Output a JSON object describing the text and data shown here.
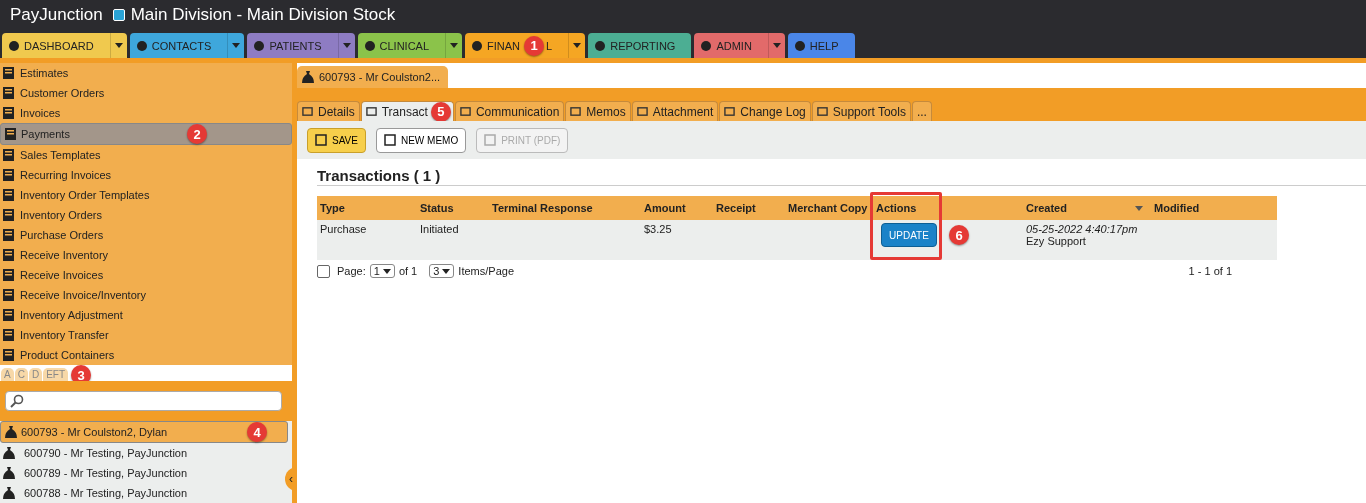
{
  "header": {
    "app": "PayJunction",
    "division": "Main Division - Main Division Stock"
  },
  "nav": [
    {
      "label": "DASHBOARD",
      "color": "#f0c94e",
      "dropdown": true
    },
    {
      "label": "CONTACTS",
      "color": "#3ea7dc",
      "dropdown": true
    },
    {
      "label": "PATIENTS",
      "color": "#8e7cc3",
      "dropdown": true
    },
    {
      "label": "CLINICAL",
      "color": "#8bc34a",
      "dropdown": true
    },
    {
      "label": "FINAN",
      "label_after": "L",
      "badge": "1",
      "color": "#f5a623",
      "dropdown": true
    },
    {
      "label": "REPORTING",
      "color": "#4cae93",
      "dropdown": false
    },
    {
      "label": "ADMIN",
      "color": "#e26a6a",
      "dropdown": true
    },
    {
      "label": "HELP",
      "color": "#4a86e8",
      "dropdown": false
    }
  ],
  "sidebar": {
    "items": [
      {
        "label": "Estimates",
        "selected": false
      },
      {
        "label": "Customer Orders",
        "selected": false
      },
      {
        "label": "Invoices",
        "selected": false
      },
      {
        "label": "Payments",
        "selected": true,
        "badge": "2"
      },
      {
        "label": "Sales Templates",
        "selected": false
      },
      {
        "label": "Recurring Invoices",
        "selected": false
      },
      {
        "label": "Inventory Order Templates",
        "selected": false
      },
      {
        "label": "Inventory Orders",
        "selected": false
      },
      {
        "label": "Purchase Orders",
        "selected": false
      },
      {
        "label": "Receive Inventory",
        "selected": false
      },
      {
        "label": "Receive Invoices",
        "selected": false
      },
      {
        "label": "Receive Invoice/Inventory",
        "selected": false
      },
      {
        "label": "Inventory Adjustment",
        "selected": false
      },
      {
        "label": "Inventory Transfer",
        "selected": false
      },
      {
        "label": "Product Containers",
        "selected": false
      }
    ],
    "filter_tabs": [
      "A",
      "C",
      "D",
      "EFT"
    ],
    "filter_badge": "3",
    "results": [
      {
        "label": "600793 - Mr Coulston2, Dylan",
        "selected": true,
        "badge": "4"
      },
      {
        "label": "600790 - Mr Testing, PayJunction",
        "selected": false
      },
      {
        "label": "600789 - Mr Testing, PayJunction",
        "selected": false
      },
      {
        "label": "600788 - Mr Testing, PayJunction",
        "selected": false
      }
    ],
    "collapse": "‹"
  },
  "record_tab": "600793 - Mr Coulston2...",
  "tabs": [
    {
      "label": "Details",
      "selected": false
    },
    {
      "label": "Transact",
      "selected": true,
      "badge": "5"
    },
    {
      "label": "Communication",
      "selected": false
    },
    {
      "label": "Memos",
      "selected": false
    },
    {
      "label": "Attachment",
      "selected": false
    },
    {
      "label": "Change Log",
      "selected": false
    },
    {
      "label": "Support Tools",
      "selected": false
    },
    {
      "label": "...",
      "selected": false
    }
  ],
  "toolbar": [
    {
      "label": "SAVE",
      "kind": "primary",
      "disabled": false
    },
    {
      "label": "NEW MEMO",
      "kind": "plain",
      "disabled": false
    },
    {
      "label": "PRINT (PDF)",
      "kind": "plain",
      "disabled": true
    }
  ],
  "section_title": "Transactions ( 1 )",
  "table": {
    "columns": [
      "Type",
      "Status",
      "Terminal Response",
      "Amount",
      "Receipt",
      "Merchant Copy",
      "Actions",
      "Created",
      "Modified"
    ],
    "rows": [
      {
        "type": "Purchase",
        "status": "Initiated",
        "amount": "$3.25",
        "action": "UPDATE",
        "action_badge": "6",
        "created": "05-25-2022 4:40:17pm",
        "created_by": "Ezy Support"
      }
    ]
  },
  "pager": {
    "checked": false,
    "page_label": "Page:",
    "page": "1",
    "of": "of 1",
    "per_page": "3",
    "per_page_label": "Items/Page",
    "range": "1 - 1 of 1"
  }
}
